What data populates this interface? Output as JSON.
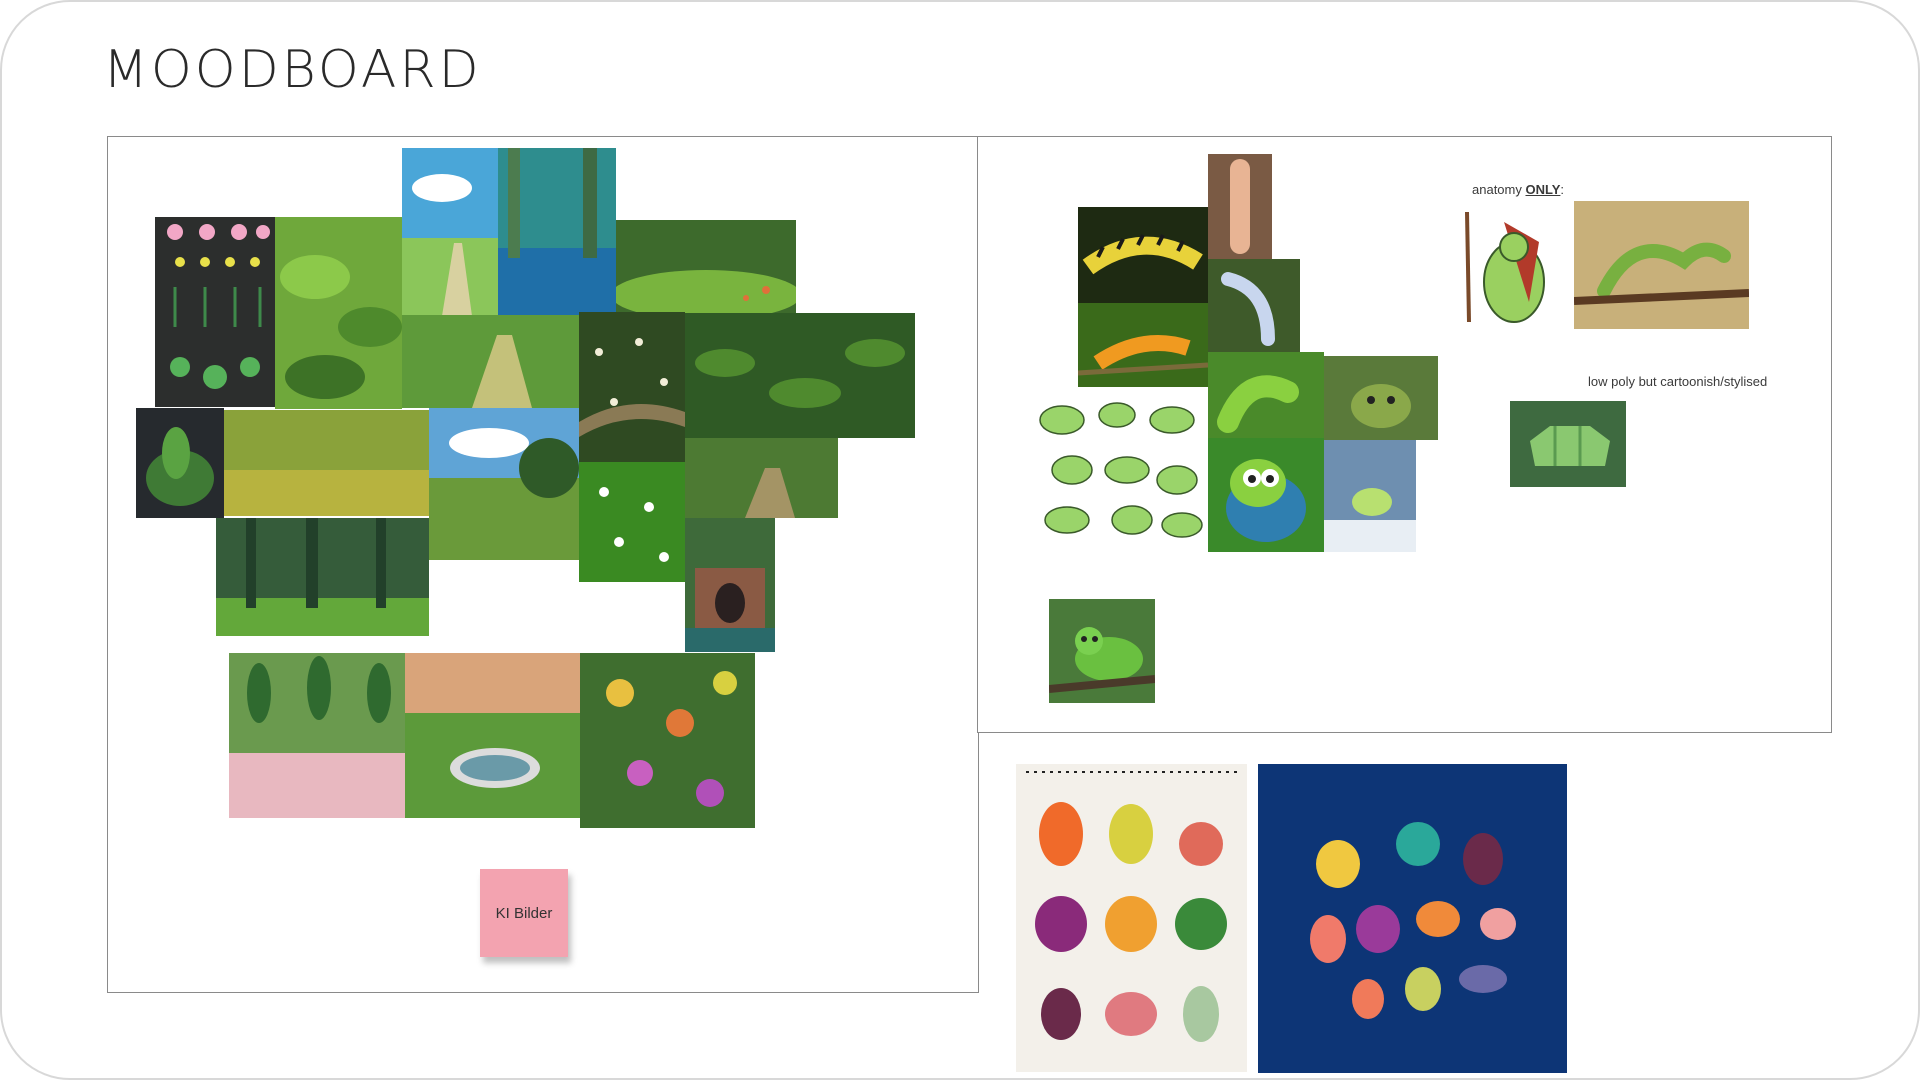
{
  "slide": {
    "title": "MOODBOARD"
  },
  "caterpillar_board": {
    "anatomy_prefix": "anatomy ",
    "anatomy_emphasis": "ONLY",
    "anatomy_suffix": ":",
    "style_note": "low poly but cartoonish/stylised"
  },
  "environment_board": {
    "sticky_note": "KI Bilder"
  },
  "palette": {
    "sticky_pink": "#f3a3b0",
    "navy_background": "#0d3576",
    "foliage_green": "#4f8a2e"
  }
}
